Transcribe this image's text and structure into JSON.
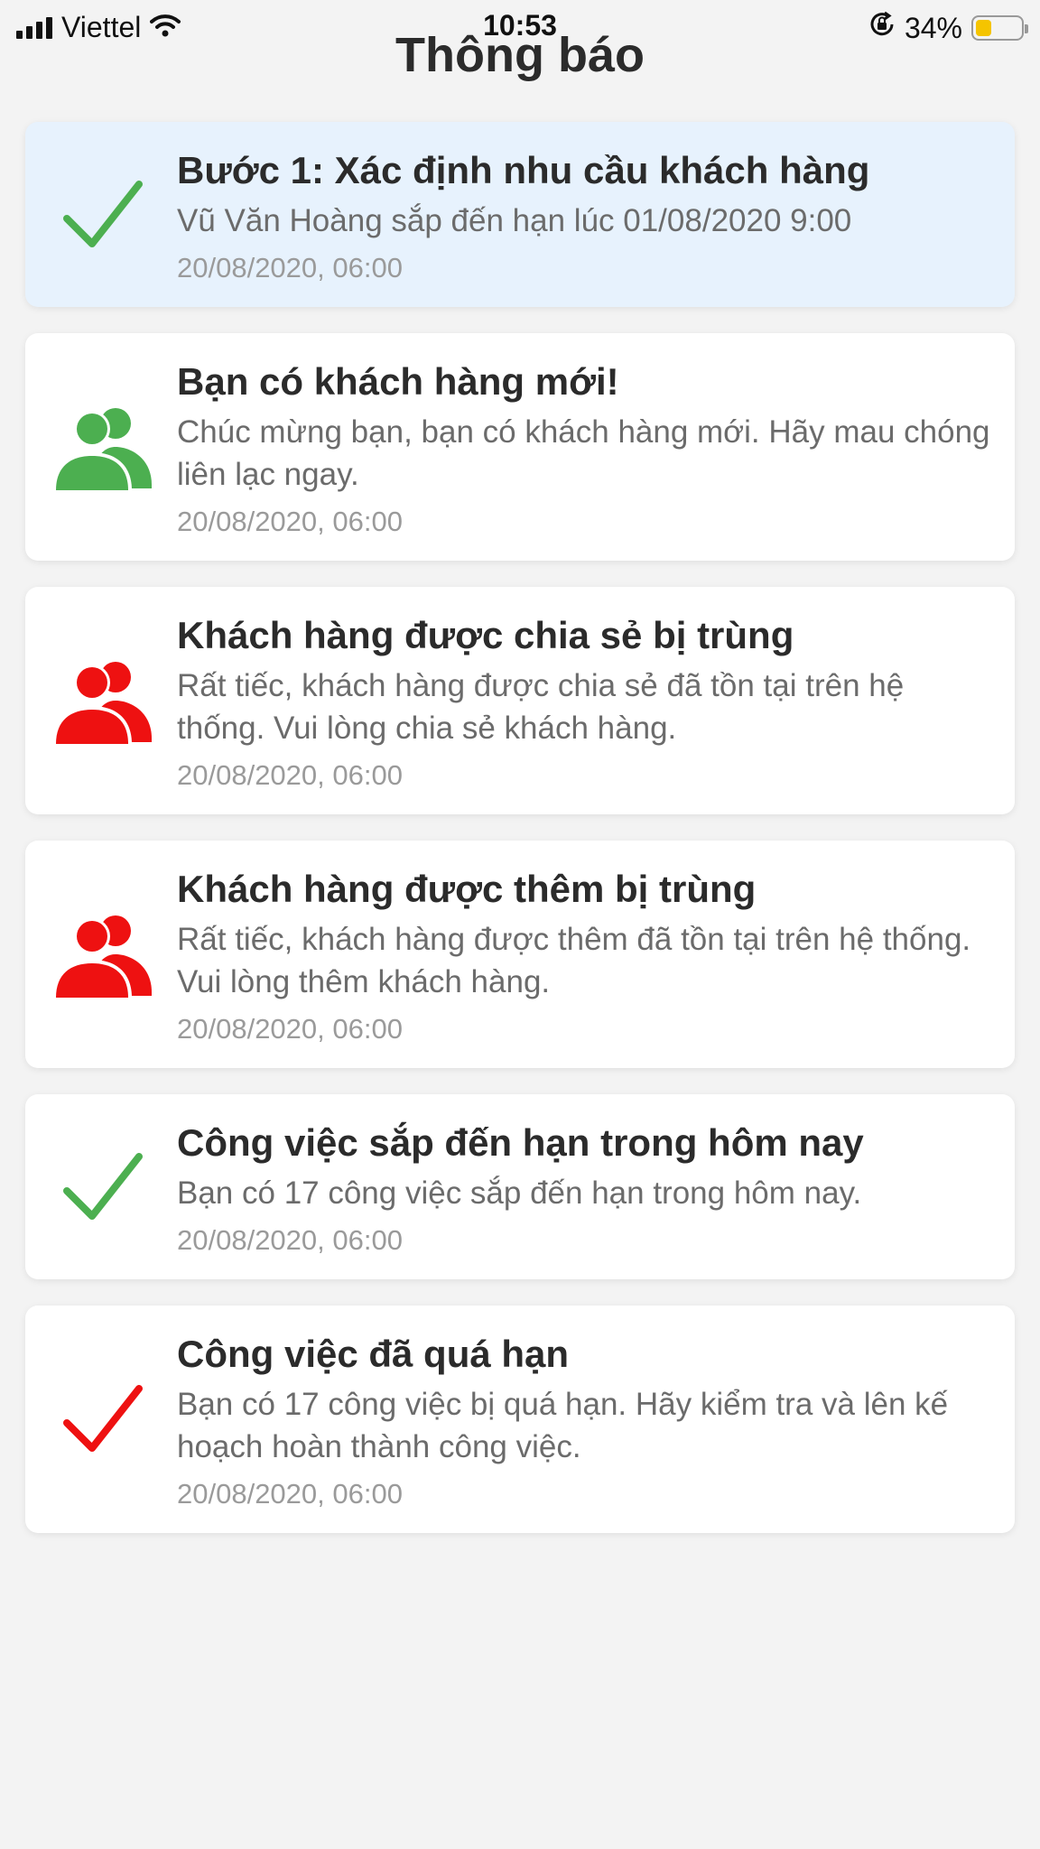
{
  "status_bar": {
    "carrier": "Viettel",
    "time": "10:53",
    "battery_percent": "34%",
    "battery_level": 0.34,
    "icons": [
      "signal-icon",
      "wifi-icon",
      "orientation-lock-icon",
      "battery-icon"
    ]
  },
  "header": {
    "title": "Thông báo"
  },
  "colors": {
    "green": "#4caf50",
    "red": "#ee1111",
    "highlight_bg": "#e7f2fd"
  },
  "notifications": [
    {
      "icon": "check-icon",
      "icon_color": "#4caf50",
      "highlighted": true,
      "title": "Bước 1: Xác định nhu cầu khách hàng",
      "body": "Vũ Văn Hoàng sắp đến hạn lúc 01/08/2020 9:00",
      "time": "20/08/2020, 06:00"
    },
    {
      "icon": "users-icon",
      "icon_color": "#4caf50",
      "highlighted": false,
      "title": "Bạn có khách hàng mới!",
      "body": "Chúc mừng bạn, bạn có khách hàng mới. Hãy mau chóng liên lạc ngay.",
      "time": "20/08/2020, 06:00"
    },
    {
      "icon": "users-icon",
      "icon_color": "#ee1111",
      "highlighted": false,
      "title": "Khách hàng được chia sẻ bị trùng",
      "body": "Rất tiếc, khách hàng được chia sẻ đã tồn tại trên hệ thống. Vui lòng chia sẻ khách hàng.",
      "time": "20/08/2020, 06:00"
    },
    {
      "icon": "users-icon",
      "icon_color": "#ee1111",
      "highlighted": false,
      "title": "Khách hàng được thêm bị trùng",
      "body": "Rất tiếc, khách hàng được thêm đã tồn tại trên hệ thống. Vui lòng thêm khách hàng.",
      "time": "20/08/2020, 06:00"
    },
    {
      "icon": "check-icon",
      "icon_color": "#4caf50",
      "highlighted": false,
      "title": "Công việc sắp đến hạn trong hôm nay",
      "body": "Bạn có 17 công việc sắp đến hạn trong hôm nay.",
      "time": "20/08/2020, 06:00"
    },
    {
      "icon": "check-icon",
      "icon_color": "#ee1111",
      "highlighted": false,
      "title": "Công việc đã quá hạn",
      "body": "Bạn có 17 công việc bị quá hạn. Hãy kiểm tra và lên kế hoạch hoàn thành công việc.",
      "time": "20/08/2020, 06:00"
    }
  ]
}
